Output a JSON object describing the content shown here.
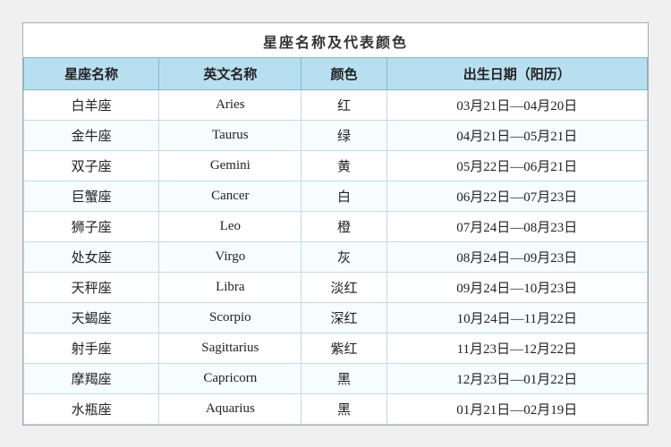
{
  "title": "星座名称及代表颜色",
  "headers": [
    "星座名称",
    "英文名称",
    "颜色",
    "出生日期（阳历）"
  ],
  "rows": [
    {
      "zh": "白羊座",
      "en": "Aries",
      "color": "红",
      "date": "03月21日—04月20日"
    },
    {
      "zh": "金牛座",
      "en": "Taurus",
      "color": "绿",
      "date": "04月21日—05月21日"
    },
    {
      "zh": "双子座",
      "en": "Gemini",
      "color": "黄",
      "date": "05月22日—06月21日"
    },
    {
      "zh": "巨蟹座",
      "en": "Cancer",
      "color": "白",
      "date": "06月22日—07月23日"
    },
    {
      "zh": "狮子座",
      "en": "Leo",
      "color": "橙",
      "date": "07月24日—08月23日"
    },
    {
      "zh": "处女座",
      "en": "Virgo",
      "color": "灰",
      "date": "08月24日—09月23日"
    },
    {
      "zh": "天秤座",
      "en": "Libra",
      "color": "淡红",
      "date": "09月24日—10月23日"
    },
    {
      "zh": "天蝎座",
      "en": "Scorpio",
      "color": "深红",
      "date": "10月24日—11月22日"
    },
    {
      "zh": "射手座",
      "en": "Sagittarius",
      "color": "紫红",
      "date": "11月23日—12月22日"
    },
    {
      "zh": "摩羯座",
      "en": "Capricorn",
      "color": "黑",
      "date": "12月23日—01月22日"
    },
    {
      "zh": "水瓶座",
      "en": "Aquarius",
      "color": "黑",
      "date": "01月21日—02月19日"
    }
  ]
}
